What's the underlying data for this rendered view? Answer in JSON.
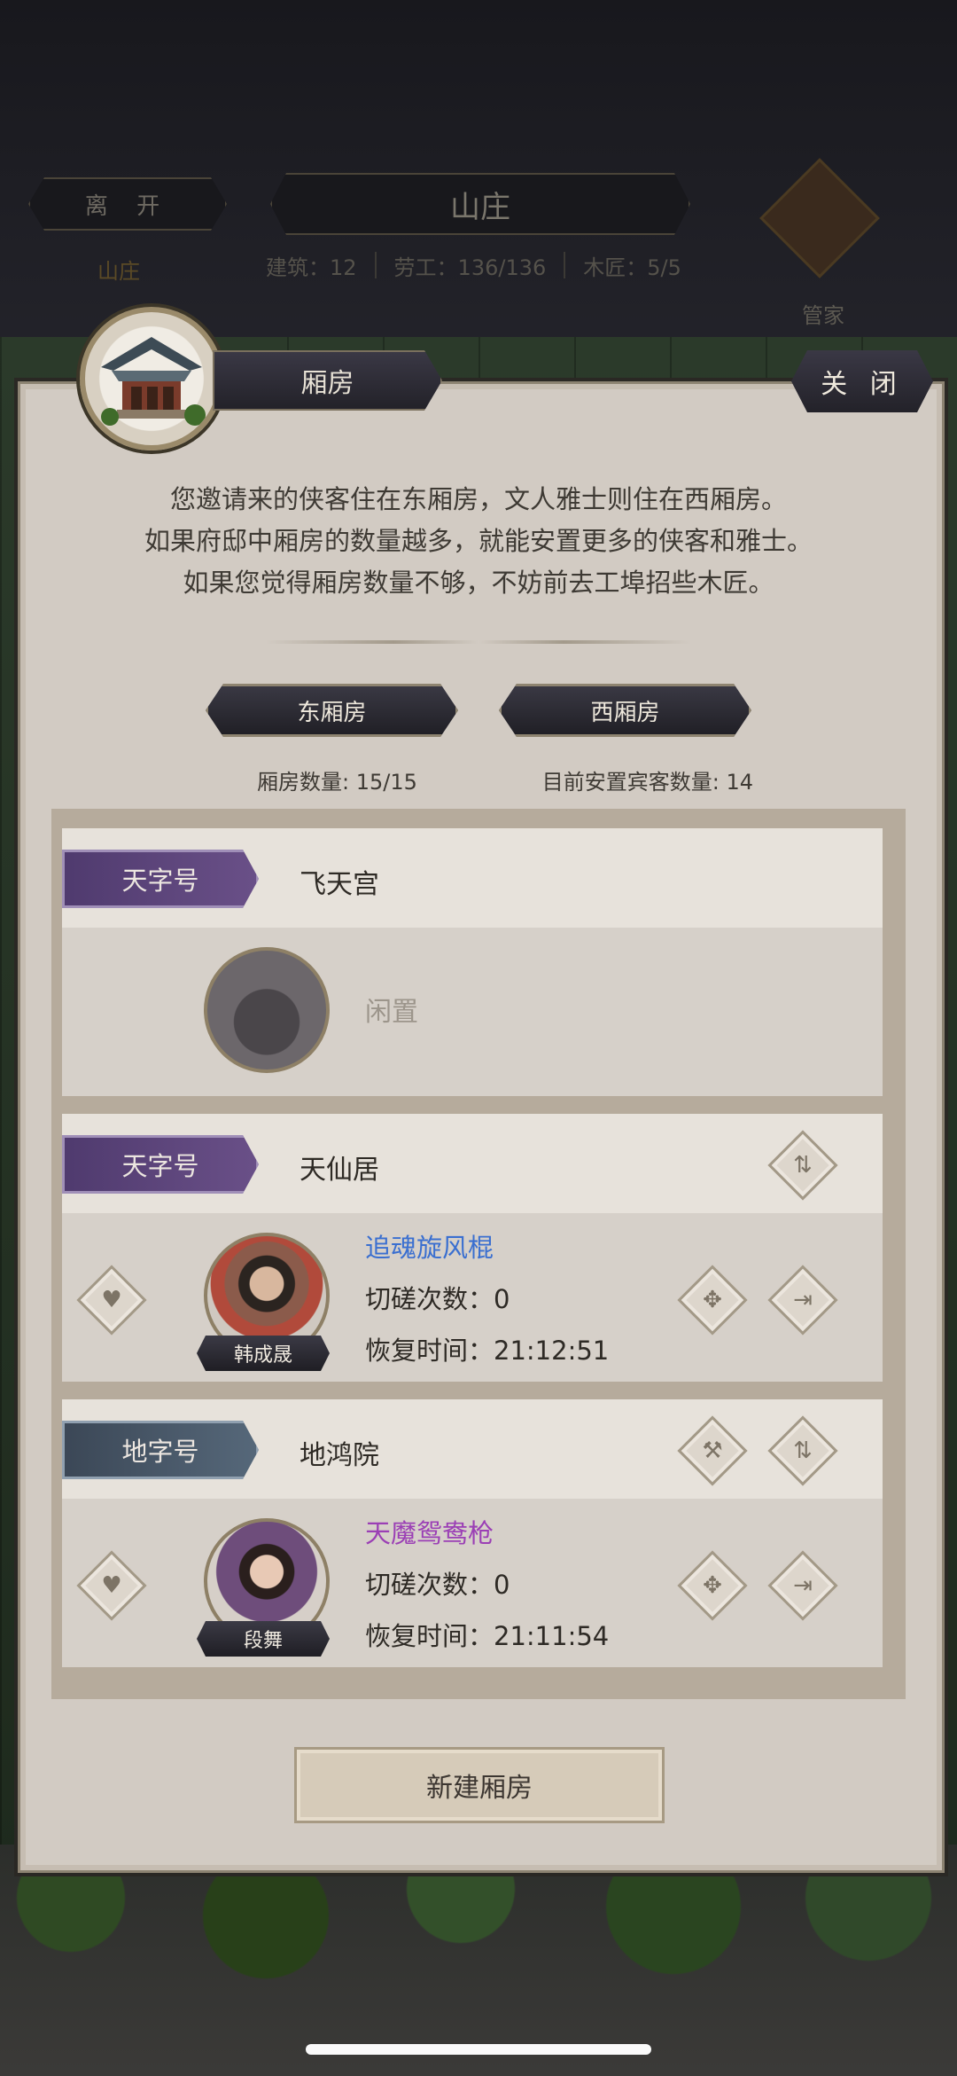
{
  "header": {
    "leave_label": "离 开",
    "title": "山庄",
    "stats": [
      "建筑：12",
      "劳工：136/136",
      "木匠：5/5"
    ],
    "estate_label": "山庄",
    "manager_label": "管家"
  },
  "dialog": {
    "tab_label": "厢房",
    "close_label": "关 闭",
    "intro_lines": [
      "您邀请来的侠客住在东厢房，文人雅士则住在西厢房。",
      "如果府邸中厢房的数量越多，就能安置更多的侠客和雅士。",
      "如果您觉得厢房数量不够，不妨前去工埠招些木匠。"
    ],
    "east_label": "东厢房",
    "west_label": "西厢房",
    "room_count": "厢房数量: 15/15",
    "guest_count": "目前安置宾客数量: 14",
    "new_room_label": "新建厢房"
  },
  "rooms": [
    {
      "tag": "天字号",
      "name": "飞天宫",
      "idle_label": "闲置"
    },
    {
      "tag": "天字号",
      "name": "天仙居",
      "guest": "韩成晟",
      "skill": "追魂旋风棍",
      "skill_color": "#3a6fd0",
      "spar_label": "切磋次数：0",
      "recover_label": "恢复时间：21:12:51"
    },
    {
      "tag": "地字号",
      "name": "地鸿院",
      "guest": "段舞",
      "skill": "天魔鸳鸯枪",
      "skill_color": "#9b3fb5",
      "spar_label": "切磋次数：0",
      "recover_label": "恢复时间：21:11:54"
    }
  ]
}
